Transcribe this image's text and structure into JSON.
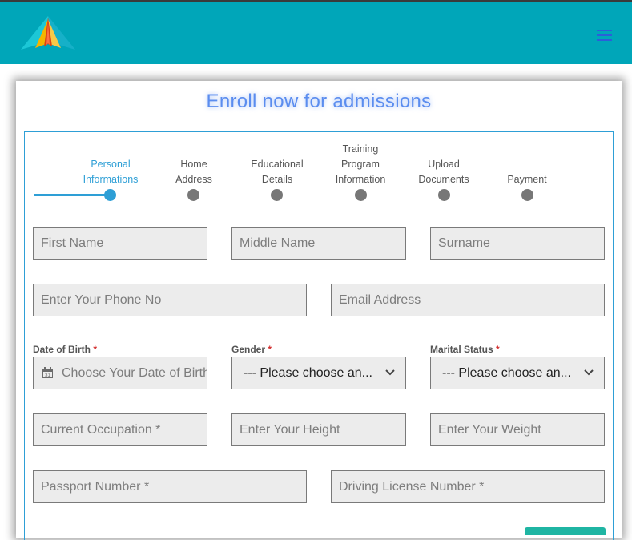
{
  "header": {
    "logo": "paper-plane-logo",
    "menu_icon": "hamburger-menu-icon",
    "background": "#00a6b9"
  },
  "form": {
    "title": "Enroll now for admissions",
    "steps": [
      {
        "label": "Personal\nInformations",
        "active": true
      },
      {
        "label": "Home\nAddress",
        "active": false
      },
      {
        "label": "Educational\nDetails",
        "active": false
      },
      {
        "label": "Training\nProgram\nInformation",
        "active": false
      },
      {
        "label": "Upload\nDocuments",
        "active": false
      },
      {
        "label": "Payment",
        "active": false
      }
    ],
    "fields": {
      "first_name": "First Name",
      "middle_name": "Middle Name",
      "surname": "Surname",
      "phone": "Enter Your Phone No",
      "email": "Email Address",
      "dob_label": "Date of Birth",
      "dob_placeholder": "Choose Your Date of Birth",
      "gender_label": "Gender",
      "gender_value": "--- Please choose an...",
      "marital_label": "Marital Status",
      "marital_value": "--- Please choose an...",
      "occupation": "Current Occupation *",
      "height": "Enter Your Height",
      "weight": "Enter Your Weight",
      "passport": "Passport Number *",
      "license": "Driving License Number *",
      "required_mark": "*"
    },
    "accent": "#2e9fd6",
    "button_color": "#1fb5a3"
  }
}
